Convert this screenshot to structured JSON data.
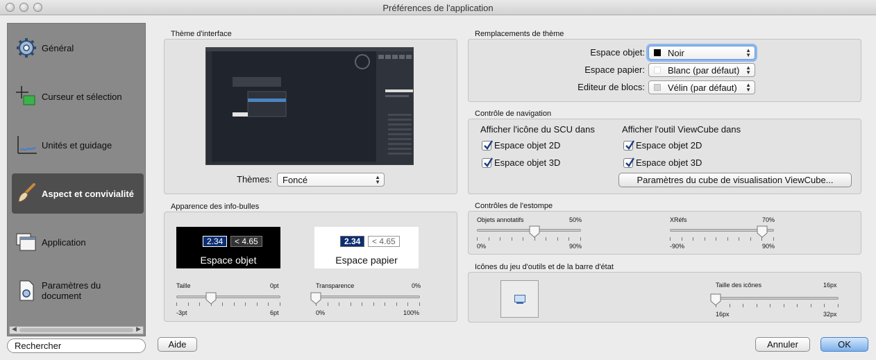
{
  "window": {
    "title": "Préférences de l'application"
  },
  "sidebar": {
    "items": [
      {
        "label": "Général",
        "icon": "gear-icon"
      },
      {
        "label": "Curseur et sélection",
        "icon": "cursor-selection-icon"
      },
      {
        "label": "Unités et guidage",
        "icon": "units-guides-icon"
      },
      {
        "label": "Aspect et convivialité",
        "icon": "brush-icon",
        "selected": true
      },
      {
        "label": "Application",
        "icon": "application-windows-icon"
      },
      {
        "label": "Paramètres du document",
        "icon": "document-settings-icon"
      }
    ]
  },
  "search": {
    "value": "Rechercher"
  },
  "theme": {
    "group_title": "Thème d'interface",
    "themes_label": "Thèmes:",
    "themes_value": "Foncé"
  },
  "tooltips": {
    "group_title": "Apparence des info-bulles",
    "dark_preview": {
      "value1": "2.34",
      "value2": "< 4.65",
      "label": "Espace objet"
    },
    "light_preview": {
      "value1": "2.34",
      "value2": "< 4.65",
      "label": "Espace papier"
    },
    "size_slider": {
      "label": "Taille",
      "value_text": "0pt",
      "min_label": "-3pt",
      "max_label": "6pt",
      "value": 0,
      "min": -3,
      "max": 6
    },
    "transparency_slider": {
      "label": "Transparence",
      "value_text": "0%",
      "min_label": "0%",
      "max_label": "100%",
      "value": 0,
      "min": 0,
      "max": 100
    }
  },
  "theme_overrides": {
    "group_title": "Remplacements de thème",
    "rows": [
      {
        "label": "Espace objet:",
        "value": "Noir",
        "swatch": "#000000"
      },
      {
        "label": "Espace papier:",
        "value": "Blanc (par défaut)",
        "swatch": "#ffffff"
      },
      {
        "label": "Editeur de blocs:",
        "value": "Vélin (par défaut)",
        "swatch": "#d6d6d6"
      }
    ]
  },
  "navigation": {
    "group_title": "Contrôle de navigation",
    "ucs_heading": "Afficher l'icône du SCU dans",
    "ucs_options": [
      {
        "label": "Espace objet 2D",
        "checked": true
      },
      {
        "label": "Espace objet 3D",
        "checked": true
      }
    ],
    "viewcube_heading": "Afficher l'outil ViewCube dans",
    "viewcube_options": [
      {
        "label": "Espace objet 2D",
        "checked": true
      },
      {
        "label": "Espace objet 3D",
        "checked": true
      }
    ],
    "viewcube_button": "Paramètres du cube de visualisation ViewCube..."
  },
  "fading": {
    "group_title": "Contrôles de l'estompe",
    "annotative_slider": {
      "label": "Objets annotatifs",
      "value_text": "50%",
      "min_label": "0%",
      "max_label": "90%",
      "value": 50,
      "min": 0,
      "max": 90
    },
    "xref_slider": {
      "label": "XRéfs",
      "value_text": "70%",
      "min_label": "-90%",
      "max_label": "90%",
      "value": 70,
      "min": -90,
      "max": 90
    }
  },
  "icons": {
    "group_title": "Icônes du jeu d'outils et de la barre d'état",
    "size_slider": {
      "label": "Taille des icônes",
      "value_text": "16px",
      "min_label": "16px",
      "max_label": "32px",
      "value": 16,
      "min": 16,
      "max": 32
    }
  },
  "buttons": {
    "help": "Aide",
    "cancel": "Annuler",
    "ok": "OK"
  },
  "colors": {
    "sidebar_bg": "#898989",
    "sidebar_selected": "#4e4e4e",
    "ok_button": "#7bb0ec",
    "tooltip_dark_bg": "#000000",
    "tooltip_field": "#0d2e73"
  }
}
